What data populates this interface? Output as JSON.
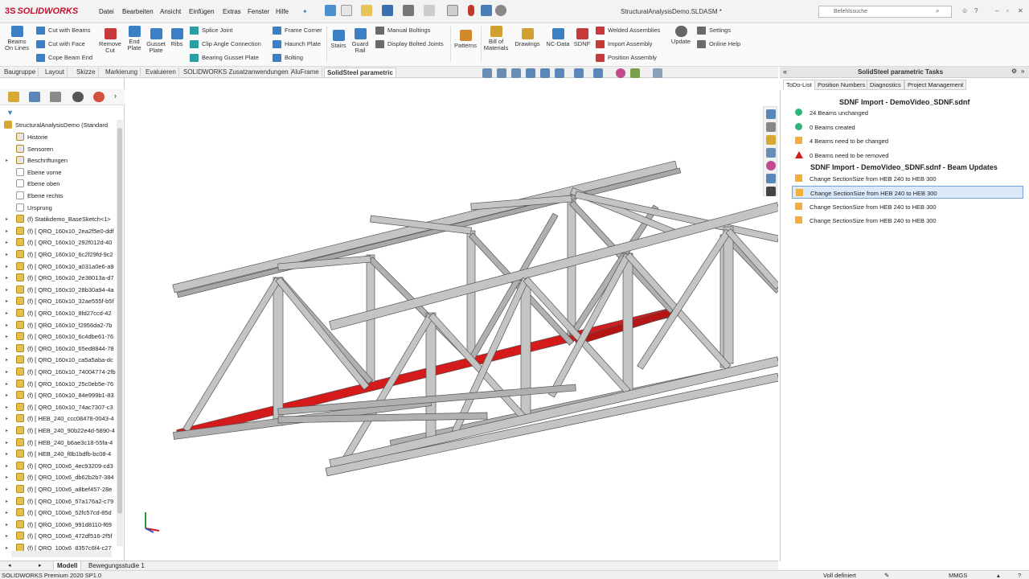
{
  "app": {
    "brand": "SOLIDWORKS",
    "doc_title": "StructuralAnalysisDemo.SLDASM *"
  },
  "menu": [
    "Datei",
    "Bearbeiten",
    "Ansicht",
    "Einfügen",
    "Extras",
    "Fenster",
    "Hilfe"
  ],
  "search": {
    "placeholder": "Befehlssuche"
  },
  "ribbon": {
    "beams_on_lines": "Beams On Lines",
    "cut_with_beams": "Cut with Beams",
    "cut_with_face": "Cut with Face",
    "cope_beam_end": "Cope Beam End",
    "remove_cut": "Remove Cut",
    "end_plate": "End Plate",
    "gusset_plate": "Gusset Plate",
    "ribs": "Ribs",
    "splice_joint": "Splice Joint",
    "clip_angle_connection": "Clip Angle Connection",
    "bearing_gusset_plate": "Bearing Gusset Plate",
    "frame_corner": "Frame Corner",
    "haunch_plate": "Haunch Plate",
    "bolting": "Bolting",
    "stairs": "Stairs",
    "guard_rail": "Guard Rail",
    "manual_boltings": "Manual Boltings",
    "display_bolted_joints": "Display Bolted Joints",
    "patterns": "Patterns",
    "bill_of_materials": "Bill of Materials",
    "drawings": "Drawings",
    "nc_data": "NC-Data",
    "sdnf": "SDNF",
    "welded_assemblies": "Welded Assemblies",
    "import_assembly": "Import Assembly",
    "position_assembly": "Position Assembly",
    "update": "Update",
    "settings": "Settings",
    "online_help": "Online Help"
  },
  "cm_tabs": [
    "Baugruppe",
    "Layout",
    "Skizze",
    "Markierung",
    "Evaluieren",
    "SOLIDWORKS Zusatzanwendungen",
    "AluFrame",
    "SolidSteel parametric"
  ],
  "cm_active": "SolidSteel parametric",
  "tree": {
    "root": "StructuralAnalysisDemo  (Standard",
    "items": [
      "Historie",
      "Sensoren",
      "Beschriftungen",
      "Ebene vorne",
      "Ebene oben",
      "Ebene rechts",
      "Ursprung",
      "(f) Statikdemo_BaseSketch<1>",
      "(f) [ QRO_160x10_2ea2f5e0-ddf",
      "(f) [ QRO_160x10_292f012d-40",
      "(f) [ QRO_160x10_6c2f29fd-9c2",
      "(f) [ QRO_160x10_a031a0e6-a9",
      "(f) [ QRO_160x10_2e38013a-d7",
      "(f) [ QRO_160x10_28b30a94-4a",
      "(f) [ QRO_160x10_32ae555f-b5f",
      "(f) [ QRO_160x10_8fd27ccd-42",
      "(f) [ QRO_160x10_f2956da2-7b",
      "(f) [ QRO_160x10_6c4dbe61-76",
      "(f) [ QRO_160x10_65ed8844-78",
      "(f) [ QRO_160x10_ca5a5aba-dc",
      "(f) [ QRO_160x10_74004774-2fb",
      "(f) [ QRO_160x10_25c0eb5e-76",
      "(f) [ QRO_160x10_84e999b1-83",
      "(f) [ QRO_160x10_74ac7307-c3",
      "(f) [ HEB_240_ccc08478-0043-4",
      "(f) [ HEB_240_90b22e4d-5890-4",
      "(f) [ HEB_240_b6ae3c18-55fa-4",
      "(f) [ HEB_240_f8b1bdfb-bc08-4",
      "(f) [ QRO_100x6_4ec93209-cd3",
      "(f) [ QRO_100x6_db62b2b7-384",
      "(f) [ QRO_100x6_a8bef457-28e",
      "(f) [ QRO_100x6_57a176a2-c79",
      "(f) [ QRO_100x6_52fc57cd-85d",
      "(f) [ QRO_100x6_991d8110-f69",
      "(f) [ QRO_100x6_472df516-2f5f",
      "(f) [ QRO_100x6_8357c6f4-c27"
    ]
  },
  "taskpane": {
    "title": "SolidSteel parametric Tasks",
    "tabs": [
      "ToDo-List",
      "Position Numbers",
      "Diagnostics",
      "Project Management"
    ],
    "active_tab": "ToDo-List",
    "section1_title": "SDNF Import - DemoVideo_SDNF.sdnf",
    "section1_items": [
      {
        "text": "24 Beams unchanged",
        "marker": "green-circle"
      },
      {
        "text": "0 Beams created",
        "marker": "green-circle"
      },
      {
        "text": "4 Beams need to be changed",
        "marker": "orange-square"
      },
      {
        "text": "0 Beams need to be removed",
        "marker": "red-triangle"
      }
    ],
    "section2_title": "SDNF Import - DemoVideo_SDNF.sdnf - Beam Updates",
    "section2_items": [
      "Change SectionSize from HEB 240 to HEB 300",
      "Change SectionSize from HEB 240 to HEB 300",
      "Change SectionSize from HEB 240 to HEB 300",
      "Change SectionSize from HEB 240 to HEB 300"
    ],
    "selected_index": 1
  },
  "bottom_tabs": [
    "Modell",
    "Bewegungsstudie 1"
  ],
  "bottom_active": "Modell",
  "status": {
    "product": "SOLIDWORKS Premium 2020 SP1.0",
    "state": "Voll definiert",
    "units": "MMGS"
  },
  "colors": {
    "accent": "#3b7fc4",
    "beam": "#b8b8b8",
    "highlight": "#d41a1a",
    "selection": "#dbe9fb"
  }
}
